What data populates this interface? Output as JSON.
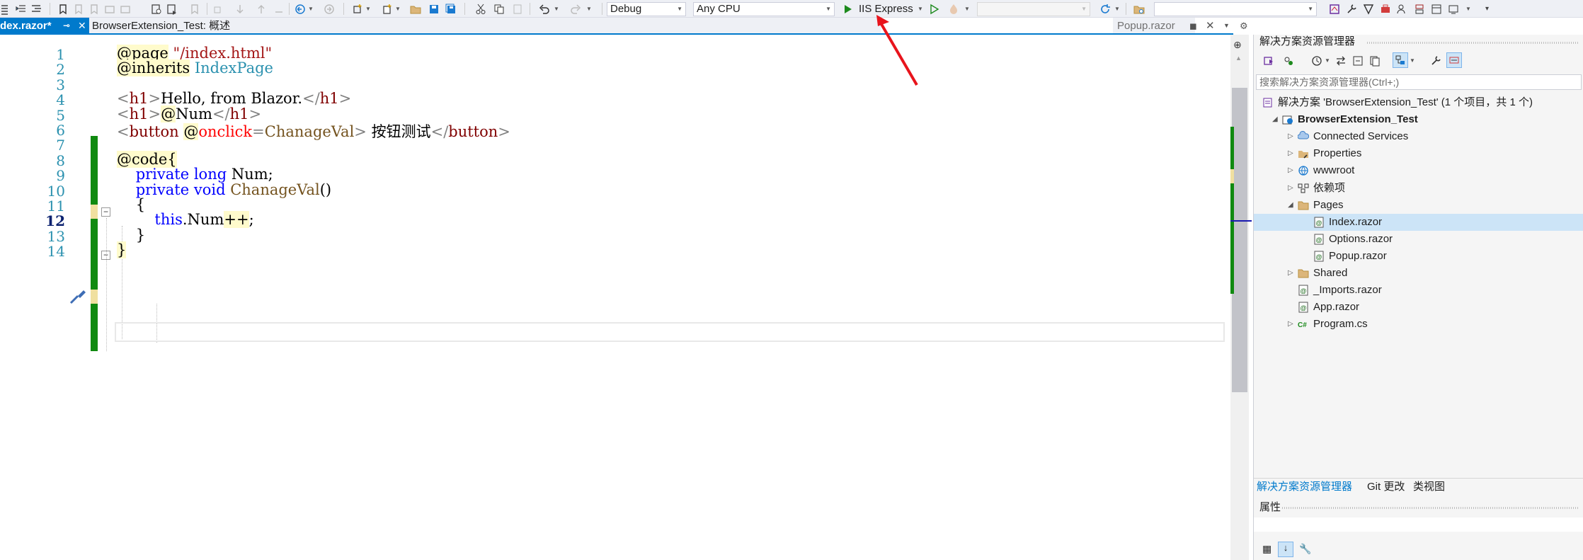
{
  "toolbar": {
    "config": "Debug",
    "platform": "Any CPU",
    "run_target": "IIS Express",
    "startup_item": "",
    "search": ""
  },
  "tabs": {
    "active": "dex.razor*",
    "second": "BrowserExtension_Test: 概述",
    "preview": "Popup.razor"
  },
  "editor": {
    "line_numbers": [
      "1",
      "2",
      "3",
      "4",
      "5",
      "6",
      "7",
      "8",
      "9",
      "10",
      "11",
      "12",
      "13",
      "14"
    ],
    "current_line": "12",
    "lines": [
      {
        "parts": [
          [
            "rz",
            "@page"
          ],
          [
            "",
            " "
          ],
          [
            "str",
            "\"/index.html\""
          ]
        ]
      },
      {
        "parts": [
          [
            "rz",
            "@inherits"
          ],
          [
            "",
            " "
          ],
          [
            "typ",
            "IndexPage"
          ]
        ]
      },
      {
        "parts": []
      },
      {
        "parts": [
          [
            "tag",
            "<"
          ],
          [
            "tn",
            "h1"
          ],
          [
            "tag",
            ">"
          ],
          [
            "",
            "Hello, from Blazor."
          ],
          [
            "tag",
            "</"
          ],
          [
            "tn",
            "h1"
          ],
          [
            "tag",
            ">"
          ]
        ]
      },
      {
        "parts": [
          [
            "tag",
            "<"
          ],
          [
            "tn",
            "h1"
          ],
          [
            "tag",
            ">"
          ],
          [
            "rz",
            "@"
          ],
          [
            "",
            "Num"
          ],
          [
            "tag",
            "</"
          ],
          [
            "tn",
            "h1"
          ],
          [
            "tag",
            ">"
          ]
        ]
      },
      {
        "parts": [
          [
            "tag",
            "<"
          ],
          [
            "tn",
            "button"
          ],
          [
            "",
            " "
          ],
          [
            "rz",
            "@"
          ],
          [
            "attr",
            "onclick"
          ],
          [
            "tag",
            "="
          ],
          [
            "meth",
            "ChanageVal"
          ],
          [
            "tag",
            ">"
          ],
          [
            "",
            " 按钮测试"
          ],
          [
            "tag",
            "</"
          ],
          [
            "tn",
            "button"
          ],
          [
            "tag",
            ">"
          ]
        ]
      },
      {
        "parts": []
      },
      {
        "parts": [
          [
            "rz",
            "@code{"
          ]
        ]
      },
      {
        "parts": [
          [
            "",
            "    "
          ],
          [
            "kw",
            "private"
          ],
          [
            "",
            " "
          ],
          [
            "kw",
            "long"
          ],
          [
            "",
            " Num;"
          ]
        ]
      },
      {
        "parts": [
          [
            "",
            "    "
          ],
          [
            "kw",
            "private"
          ],
          [
            "",
            " "
          ],
          [
            "kw",
            "void"
          ],
          [
            "",
            " "
          ],
          [
            "meth",
            "ChanageVal"
          ],
          [
            "",
            "()"
          ]
        ]
      },
      {
        "parts": [
          [
            "",
            "    {"
          ]
        ]
      },
      {
        "parts": [
          [
            "",
            "        "
          ],
          [
            "kw",
            "this"
          ],
          [
            "",
            ".Num"
          ],
          [
            "rz",
            "++"
          ],
          [
            "",
            ";"
          ]
        ]
      },
      {
        "parts": [
          [
            "",
            "    }"
          ]
        ]
      },
      {
        "parts": [
          [
            "rz",
            "}"
          ]
        ]
      }
    ]
  },
  "solution_explorer": {
    "title": "解决方案资源管理器",
    "search_placeholder": "搜索解决方案资源管理器(Ctrl+;)",
    "tree": [
      {
        "label": "解决方案 'BrowserExtension_Test' (1 个项目，共 1 个)",
        "icon": "solution-icon",
        "indent": 0,
        "expander": "",
        "bold": false,
        "selected": false
      },
      {
        "label": "BrowserExtension_Test",
        "icon": "web-project-icon",
        "indent": 1,
        "expander": "expanded",
        "bold": true,
        "selected": false
      },
      {
        "label": "Connected Services",
        "icon": "connected-services-icon",
        "indent": 2,
        "expander": "collapsed",
        "bold": false,
        "selected": false
      },
      {
        "label": "Properties",
        "icon": "properties-icon",
        "indent": 2,
        "expander": "collapsed",
        "bold": false,
        "selected": false
      },
      {
        "label": "wwwroot",
        "icon": "globe-icon",
        "indent": 2,
        "expander": "collapsed",
        "bold": false,
        "selected": false
      },
      {
        "label": "依赖项",
        "icon": "dependencies-icon",
        "indent": 2,
        "expander": "collapsed",
        "bold": false,
        "selected": false
      },
      {
        "label": "Pages",
        "icon": "folder-icon",
        "indent": 2,
        "expander": "expanded",
        "bold": false,
        "selected": false
      },
      {
        "label": "Index.razor",
        "icon": "razor-file-icon",
        "indent": 3,
        "expander": "",
        "bold": false,
        "selected": true
      },
      {
        "label": "Options.razor",
        "icon": "razor-file-icon",
        "indent": 3,
        "expander": "",
        "bold": false,
        "selected": false
      },
      {
        "label": "Popup.razor",
        "icon": "razor-file-icon",
        "indent": 3,
        "expander": "",
        "bold": false,
        "selected": false
      },
      {
        "label": "Shared",
        "icon": "folder-icon",
        "indent": 2,
        "expander": "collapsed",
        "bold": false,
        "selected": false
      },
      {
        "label": "_Imports.razor",
        "icon": "razor-file-icon",
        "indent": 2,
        "expander": "",
        "bold": false,
        "selected": false
      },
      {
        "label": "App.razor",
        "icon": "razor-file-icon",
        "indent": 2,
        "expander": "",
        "bold": false,
        "selected": false
      },
      {
        "label": "Program.cs",
        "icon": "csharp-file-icon",
        "indent": 2,
        "expander": "collapsed",
        "bold": false,
        "selected": false
      }
    ],
    "bottom_tabs": [
      "解决方案资源管理器",
      "Git 更改",
      "类视图"
    ]
  },
  "properties": {
    "title": "属性"
  },
  "colors": {
    "accent": "#007acc",
    "change_bar": "#108a10",
    "annotation_arrow": "#e8141c"
  }
}
